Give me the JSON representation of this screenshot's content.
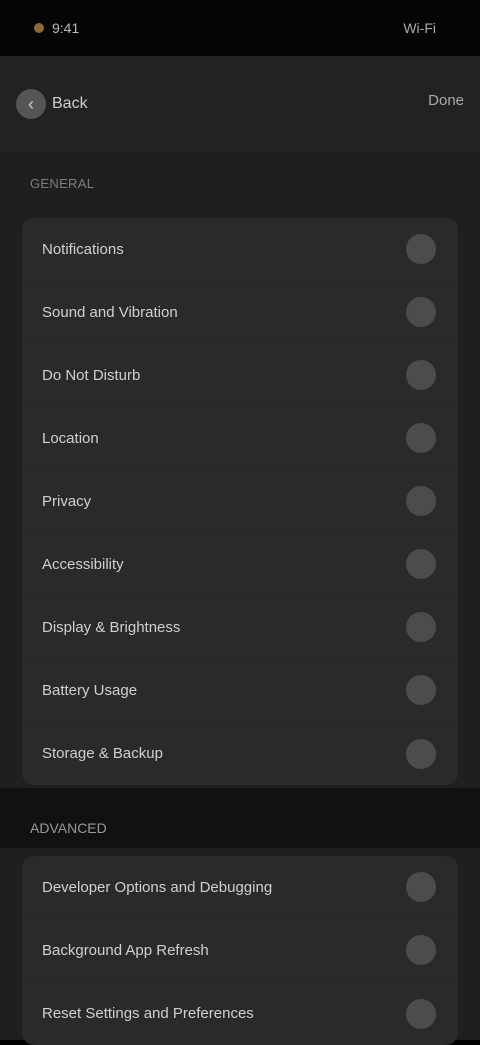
{
  "status_bar": {
    "time": "9:41",
    "indicator": "Wi-Fi"
  },
  "nav": {
    "back_label": "Back",
    "back_icon": "chevron-left-icon",
    "action_label": "Done"
  },
  "group_one": {
    "title": "GENERAL",
    "items": [
      {
        "label": "Notifications"
      },
      {
        "label": "Sound and Vibration"
      },
      {
        "label": "Do Not Disturb"
      },
      {
        "label": "Location"
      },
      {
        "label": "Privacy"
      },
      {
        "label": "Accessibility"
      },
      {
        "label": "Display & Brightness"
      },
      {
        "label": "Battery Usage"
      },
      {
        "label": "Storage & Backup"
      }
    ]
  },
  "group_two": {
    "title": "ADVANCED",
    "items": [
      {
        "label": "Developer Options and Debugging"
      },
      {
        "label": "Background App Refresh"
      },
      {
        "label": "Reset Settings and Preferences"
      }
    ]
  },
  "colors": {
    "background": "#1f1f1f",
    "row_bg": "#2a2a2a",
    "check_bg": "#4c4c4c"
  }
}
